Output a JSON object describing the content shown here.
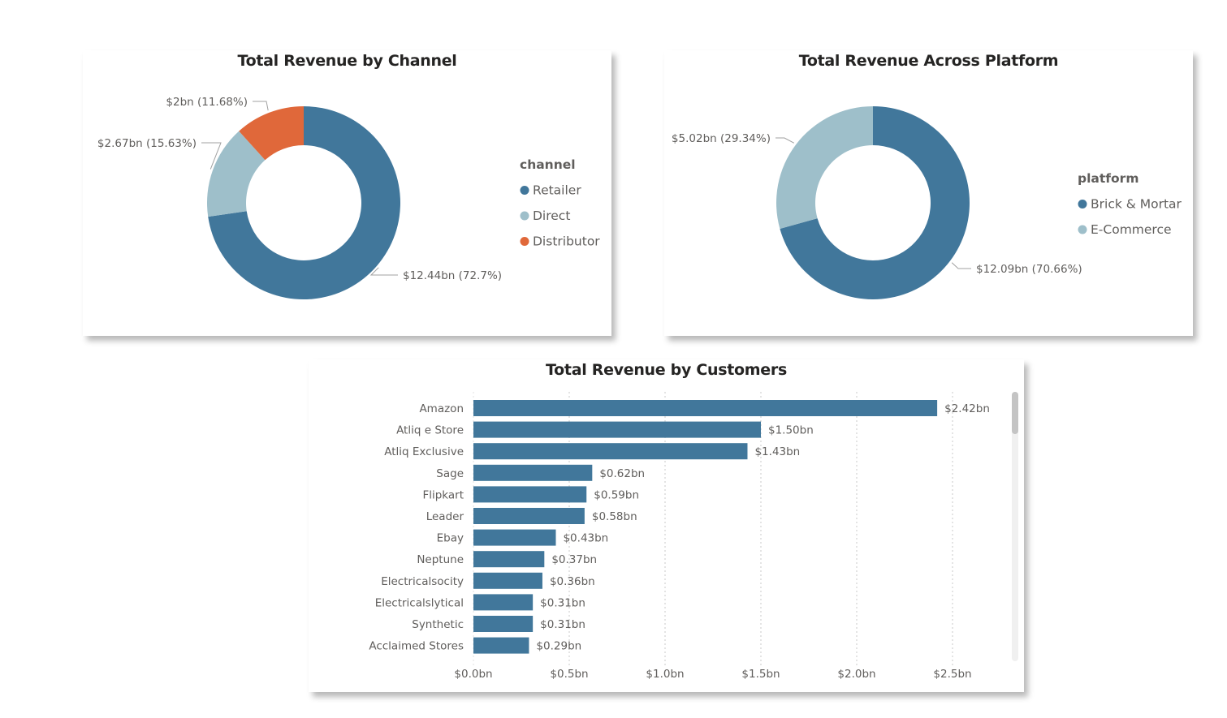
{
  "colors": {
    "retailer": "#41779b",
    "direct": "#9ebfca",
    "distributor": "#e0683a",
    "bar": "#41779b",
    "label": "#605e5c",
    "grid": "#c8c8c8"
  },
  "chart_data": [
    {
      "type": "pie",
      "title": "Total Revenue by Channel",
      "legend_title": "channel",
      "legend_position": "right",
      "slices": [
        {
          "name": "Retailer",
          "value": 12.44,
          "label": "$12.44bn (72.7%)",
          "color": "#41779b"
        },
        {
          "name": "Direct",
          "value": 2.67,
          "label": "$2.67bn (15.63%)",
          "color": "#9ebfca"
        },
        {
          "name": "Distributor",
          "value": 2.0,
          "label": "$2bn (11.68%)",
          "color": "#e0683a"
        }
      ]
    },
    {
      "type": "pie",
      "title": "Total Revenue Across Platform",
      "legend_title": "platform",
      "legend_position": "right",
      "slices": [
        {
          "name": "Brick & Mortar",
          "value": 12.09,
          "label": "$12.09bn (70.66%)",
          "color": "#41779b"
        },
        {
          "name": "E-Commerce",
          "value": 5.02,
          "label": "$5.02bn (29.34%)",
          "color": "#9ebfca"
        }
      ]
    },
    {
      "type": "bar",
      "orientation": "horizontal",
      "title": "Total Revenue by Customers",
      "categories": [
        "Amazon",
        "Atliq e Store",
        "Atliq Exclusive",
        "Sage",
        "Flipkart",
        "Leader",
        "Ebay",
        "Neptune",
        "Electricalsocity",
        "Electricalslytical",
        "Synthetic",
        "Acclaimed Stores"
      ],
      "values": [
        2.42,
        1.5,
        1.43,
        0.62,
        0.59,
        0.58,
        0.43,
        0.37,
        0.36,
        0.31,
        0.31,
        0.29
      ],
      "value_labels": [
        "$2.42bn",
        "$1.50bn",
        "$1.43bn",
        "$0.62bn",
        "$0.59bn",
        "$0.58bn",
        "$0.43bn",
        "$0.37bn",
        "$0.36bn",
        "$0.31bn",
        "$0.31bn",
        "$0.29bn"
      ],
      "xlim": [
        0,
        2.5
      ],
      "xticks": [
        0,
        0.5,
        1.0,
        1.5,
        2.0,
        2.5
      ],
      "xtick_labels": [
        "$0.0bn",
        "$0.5bn",
        "$1.0bn",
        "$1.5bn",
        "$2.0bn",
        "$2.5bn"
      ],
      "grid": true
    }
  ]
}
